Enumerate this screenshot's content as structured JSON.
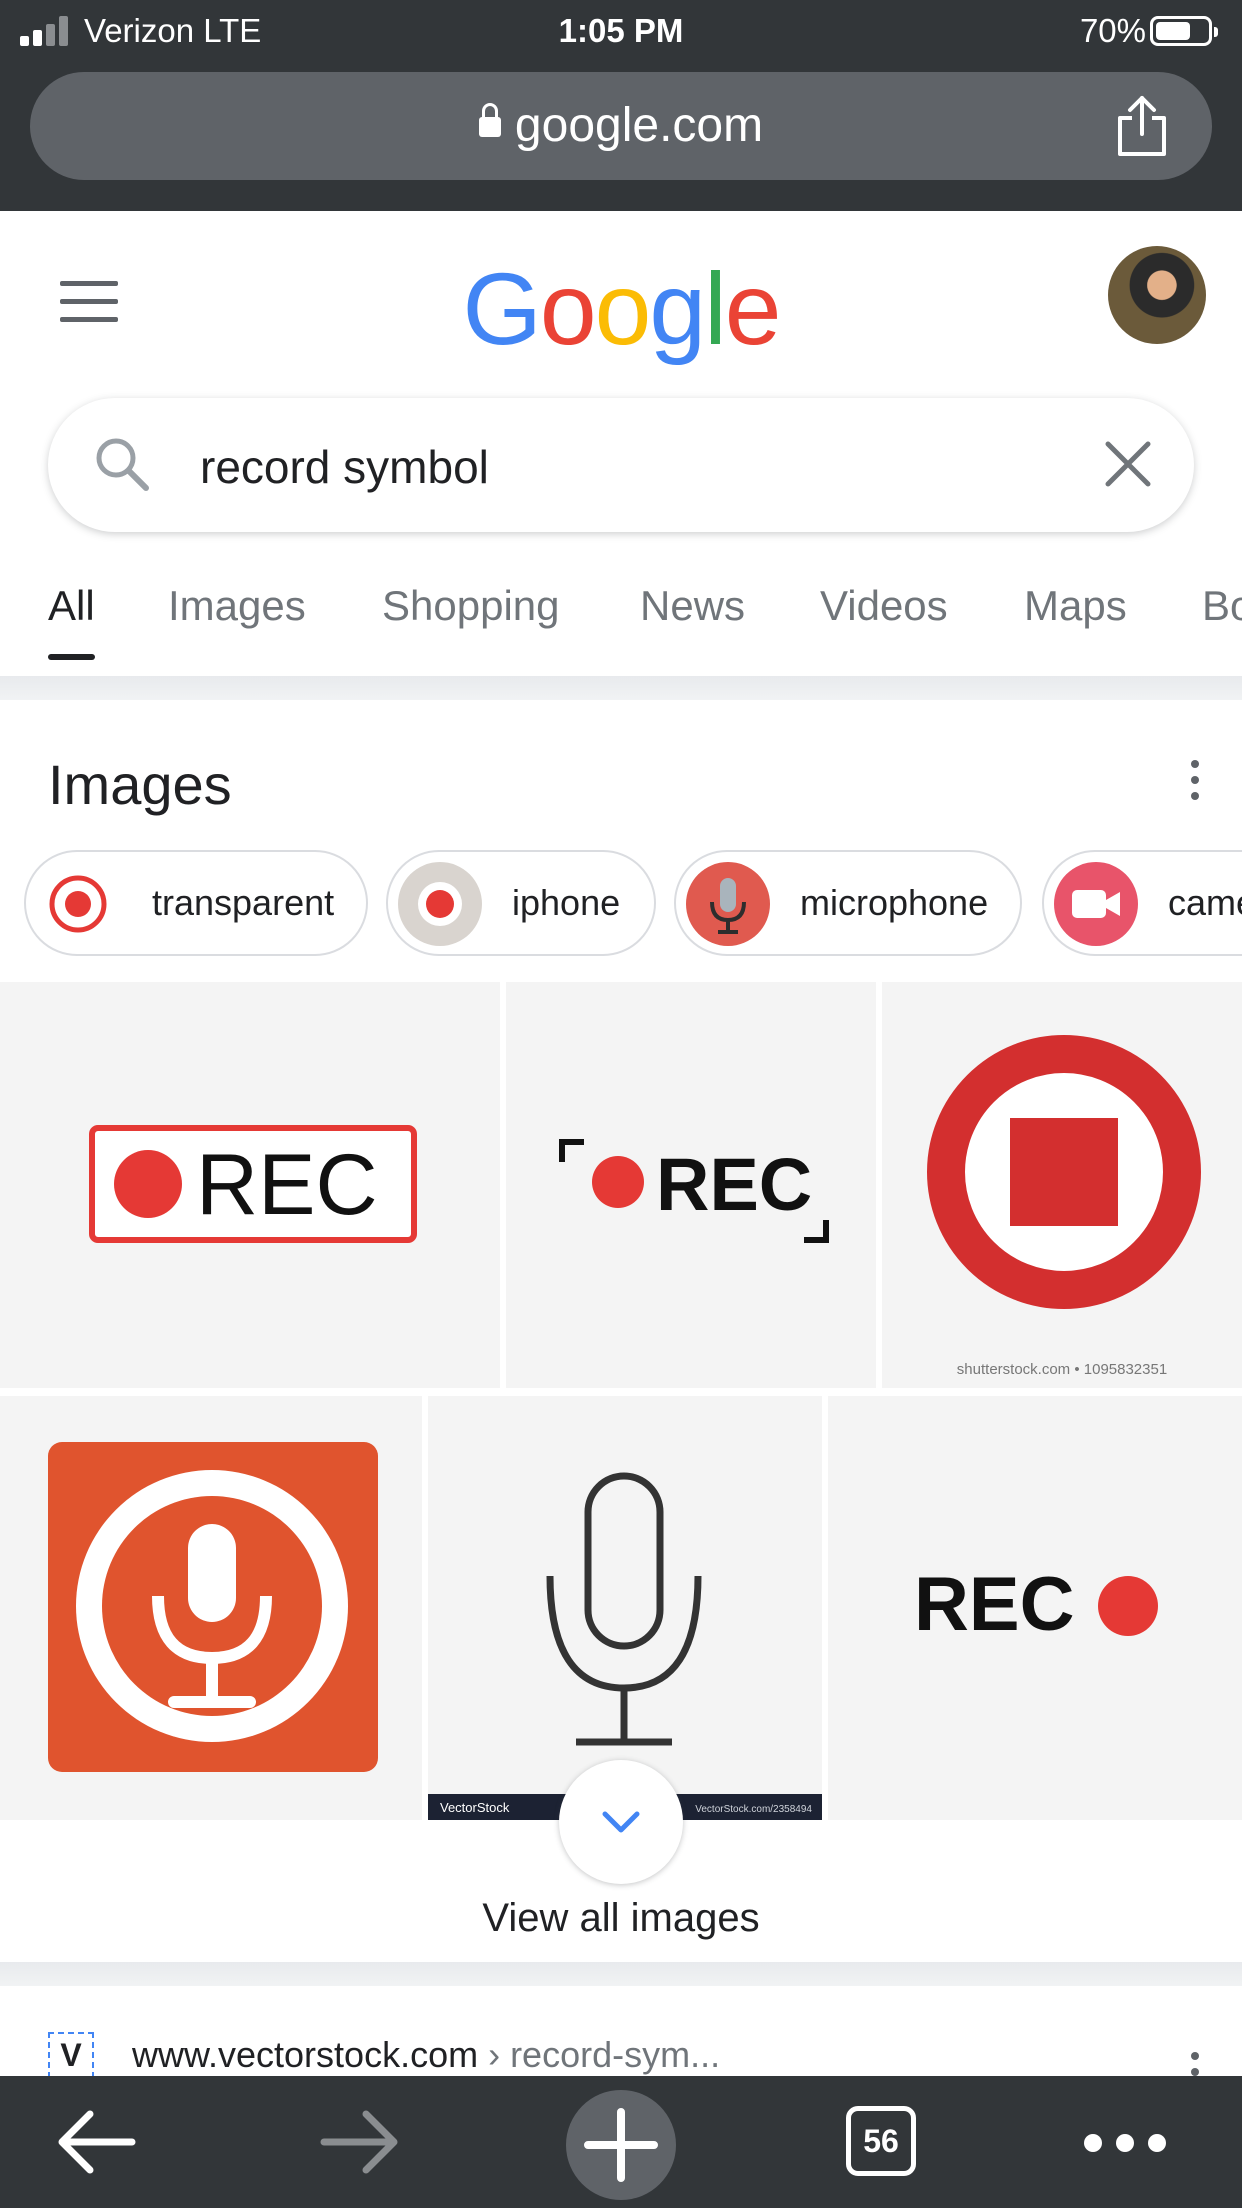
{
  "status_bar": {
    "carrier": "Verizon  LTE",
    "time": "1:05 PM",
    "battery": "70%",
    "battery_level": 0.7
  },
  "browser": {
    "url": "google.com",
    "share_icon": "share-icon",
    "lock_icon": "lock-icon"
  },
  "google": {
    "logo_letters": [
      "G",
      "o",
      "o",
      "g",
      "l",
      "e"
    ],
    "menu_icon": "hamburger-icon"
  },
  "search": {
    "query": "record symbol",
    "search_icon": "search-icon",
    "clear_icon": "close-icon"
  },
  "tabs": [
    {
      "label": "All",
      "active": true
    },
    {
      "label": "Images",
      "active": false
    },
    {
      "label": "Shopping",
      "active": false
    },
    {
      "label": "News",
      "active": false
    },
    {
      "label": "Videos",
      "active": false
    },
    {
      "label": "Maps",
      "active": false
    },
    {
      "label": "Bo",
      "active": false
    }
  ],
  "images_section": {
    "title": "Images",
    "chips": [
      {
        "label": "transparent"
      },
      {
        "label": "iphone"
      },
      {
        "label": "microphone"
      },
      {
        "label": "came"
      }
    ],
    "tiles": [
      {
        "rec_text": "REC"
      },
      {
        "rec_text": "REC"
      },
      {
        "caption": "shutterstock.com • 1095832351"
      },
      {},
      {
        "left_caption": "VectorStock",
        "right_caption": "VectorStock.com/2358494"
      },
      {
        "rec_text": "REC"
      }
    ],
    "view_all_label": "View all images"
  },
  "result": {
    "site": "www.vectorstock.com",
    "path": " › record-sym...",
    "favicon_letter": "V"
  },
  "toolbar": {
    "tab_count": "56"
  },
  "colors": {
    "chrome_dark": "#323639",
    "url_bar": "#5f6368",
    "google_blue": "#4285f4",
    "google_red": "#ea4335",
    "google_yellow": "#fbbc05",
    "google_green": "#34a853",
    "rec_red": "#e53935",
    "mic_orange": "#e0542e"
  }
}
